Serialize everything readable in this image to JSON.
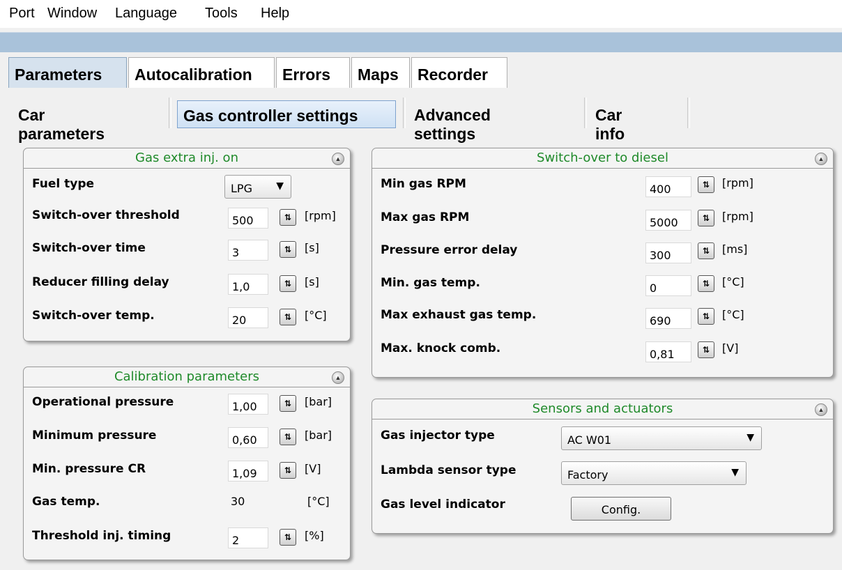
{
  "menu": [
    "Port",
    "Window",
    "Language",
    "Tools",
    "Help"
  ],
  "main_tabs": [
    "Parameters",
    "Autocalibration",
    "Errors",
    "Maps",
    "Recorder"
  ],
  "sub_tabs": [
    "Car parameters",
    "Gas controller settings",
    "Advanced settings",
    "Car info"
  ],
  "gas_extra": {
    "title": "Gas extra inj. on",
    "fuel_type_label": "Fuel type",
    "fuel_type_value": "LPG",
    "rows": [
      {
        "label": "Switch-over threshold",
        "value": "500",
        "unit": "[rpm]"
      },
      {
        "label": "Switch-over time",
        "value": "3",
        "unit": "[s]"
      },
      {
        "label": "Reducer filling delay",
        "value": "1,0",
        "unit": "[s]"
      },
      {
        "label": "Switch-over temp.",
        "value": "20",
        "unit": "[°C]"
      }
    ]
  },
  "calibration": {
    "title": "Calibration parameters",
    "rows": [
      {
        "label": "Operational pressure",
        "value": "1,00",
        "unit": "[bar]"
      },
      {
        "label": "Minimum pressure",
        "value": "0,60",
        "unit": "[bar]"
      },
      {
        "label": "Min. pressure CR",
        "value": "1,09",
        "unit": "[V]"
      }
    ],
    "gas_temp": {
      "label": "Gas temp.",
      "value": "30",
      "unit": "[°C]"
    },
    "threshold": {
      "label": "Threshold inj. timing",
      "value": "2",
      "unit": "[%]"
    }
  },
  "switch_diesel": {
    "title": "Switch-over to diesel",
    "rows": [
      {
        "label": "Min gas RPM",
        "value": "400",
        "unit": "[rpm]"
      },
      {
        "label": "Max gas RPM",
        "value": "5000",
        "unit": "[rpm]"
      },
      {
        "label": "Pressure error delay",
        "value": "300",
        "unit": "[ms]"
      },
      {
        "label": "Min. gas temp.",
        "value": "0",
        "unit": "[°C]"
      },
      {
        "label": "Max exhaust gas temp.",
        "value": "690",
        "unit": "[°C]"
      },
      {
        "label": "Max. knock comb.",
        "value": "0,81",
        "unit": "[V]"
      }
    ]
  },
  "sensors": {
    "title": "Sensors and actuators",
    "injector_label": "Gas injector type",
    "injector_value": "AC W01",
    "lambda_label": "Lambda sensor type",
    "lambda_value": "Factory",
    "level_label": "Gas level indicator",
    "config_button": "Config."
  }
}
